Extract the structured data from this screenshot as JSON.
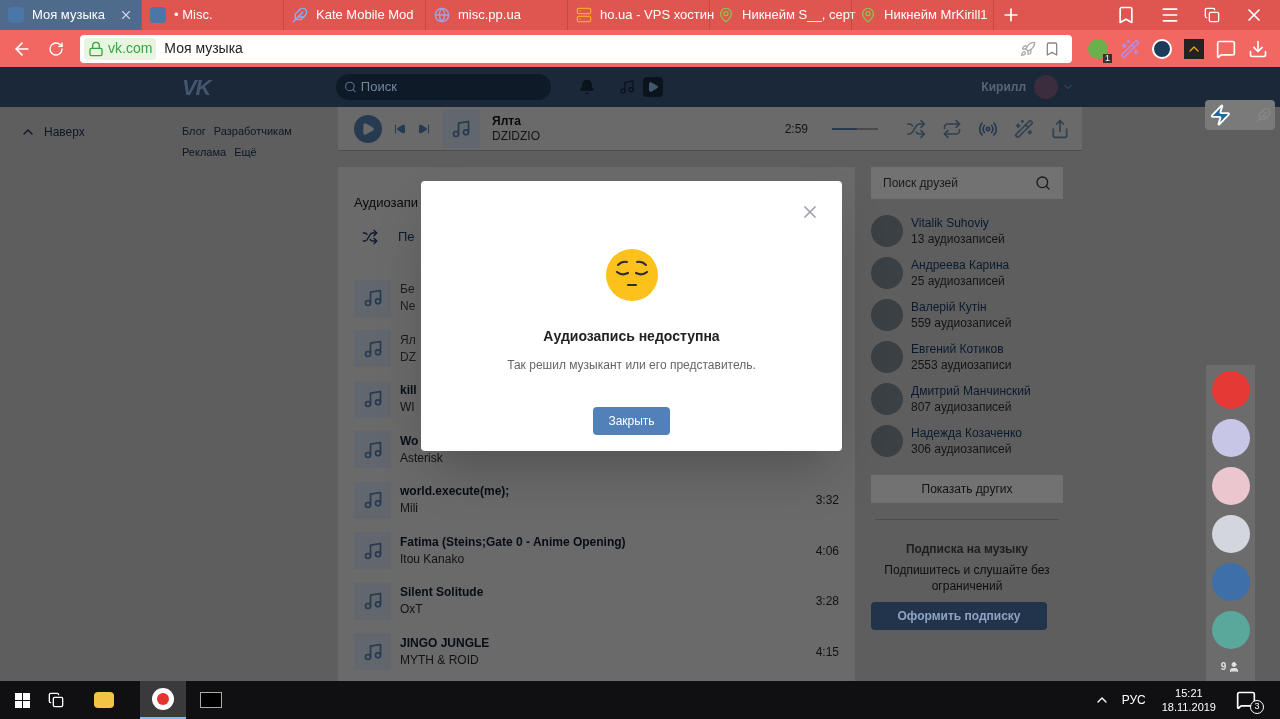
{
  "browser": {
    "tabs": [
      {
        "title": "Моя музыка",
        "selected": true,
        "kind": "vk"
      },
      {
        "title": "• Misc.",
        "selected": false,
        "kind": "vk"
      },
      {
        "title": "Kate Mobile Mod",
        "selected": false,
        "kind": "kate"
      },
      {
        "title": "misc.pp.ua",
        "selected": false,
        "kind": "globe"
      },
      {
        "title": "ho.ua - VPS хостин",
        "selected": false,
        "kind": "server"
      },
      {
        "title": "Никнейм S__, серт",
        "selected": false,
        "kind": "pin"
      },
      {
        "title": "Никнейм MrKirill1",
        "selected": false,
        "kind": "pin"
      }
    ],
    "address": {
      "domain": "vk.com",
      "title": "Моя музыка"
    },
    "extension_badge": "1"
  },
  "header": {
    "logo": "VK",
    "search": {
      "placeholder": "Поиск"
    },
    "user": "Кирилл"
  },
  "left": {
    "back_to_top": "Наверх",
    "footer_links": [
      "Блог",
      "Разработчикам",
      "Реклама",
      "Ещё"
    ]
  },
  "player": {
    "title": "Ялта",
    "artist": "DZIDZIO",
    "time": "2:59",
    "volume": {
      "level": 0.55
    }
  },
  "audio": {
    "heading": "Аудиозапи",
    "shuffle_label": "Пе",
    "tracks": [
      {
        "title": "Бе",
        "artist": "Ne",
        "disabled": true
      },
      {
        "title": "Ял",
        "artist": "DZ",
        "disabled": true
      },
      {
        "title": "kill",
        "artist": "WI",
        "disabled": false
      },
      {
        "title": "Wo",
        "artist": "Asterisk",
        "disabled": false
      },
      {
        "title": "world.execute(me);",
        "artist": "Mili",
        "duration": "3:32",
        "disabled": false
      },
      {
        "title": "Fatima (Steins;Gate 0 - Anime Opening)",
        "artist": "Itou Kanako",
        "duration": "4:06",
        "disabled": false
      },
      {
        "title": "Silent Solitude",
        "artist": "OxT",
        "duration": "3:28",
        "disabled": false
      },
      {
        "title": "JINGO JUNGLE",
        "artist": "MYTH & ROID",
        "duration": "4:15",
        "disabled": false
      }
    ]
  },
  "friends": {
    "search": {
      "placeholder": "Поиск друзей"
    },
    "items": [
      {
        "name": "Vitalik Suhoviy",
        "count": "13 аудиозаписей"
      },
      {
        "name": "Андреева Карина",
        "count": "25 аудиозаписей"
      },
      {
        "name": "Валерій Кутін",
        "count": "559 аудиозаписей"
      },
      {
        "name": "Евгений Котиков",
        "count": "2553 аудиозаписи"
      },
      {
        "name": "Дмитрий Манчинский",
        "count": "807 аудиозаписей"
      },
      {
        "name": "Надежда Козаченко",
        "count": "306 аудиозаписей"
      }
    ],
    "show_more": "Показать других"
  },
  "subscription": {
    "title": "Подписка на музыку",
    "text": "Подпишитесь и слушайте без ограничений",
    "button": "Оформить подписку"
  },
  "chat_bar": {
    "avatars": [
      {
        "color": "#e53935"
      },
      {
        "color": "#c8c6e6"
      },
      {
        "color": "#ecc6cf"
      },
      {
        "color": "#d3d7dd"
      },
      {
        "color": "#3e6fa8"
      },
      {
        "color": "#5aa79c"
      }
    ],
    "online_count": "9"
  },
  "modal": {
    "title": "Аудиозапись недоступна",
    "text": "Так решил музыкант или его представитель.",
    "button": "Закрыть"
  },
  "taskbar": {
    "language": "РУС",
    "time": "15:21",
    "date": "18.11.2019",
    "notifications": "3"
  }
}
